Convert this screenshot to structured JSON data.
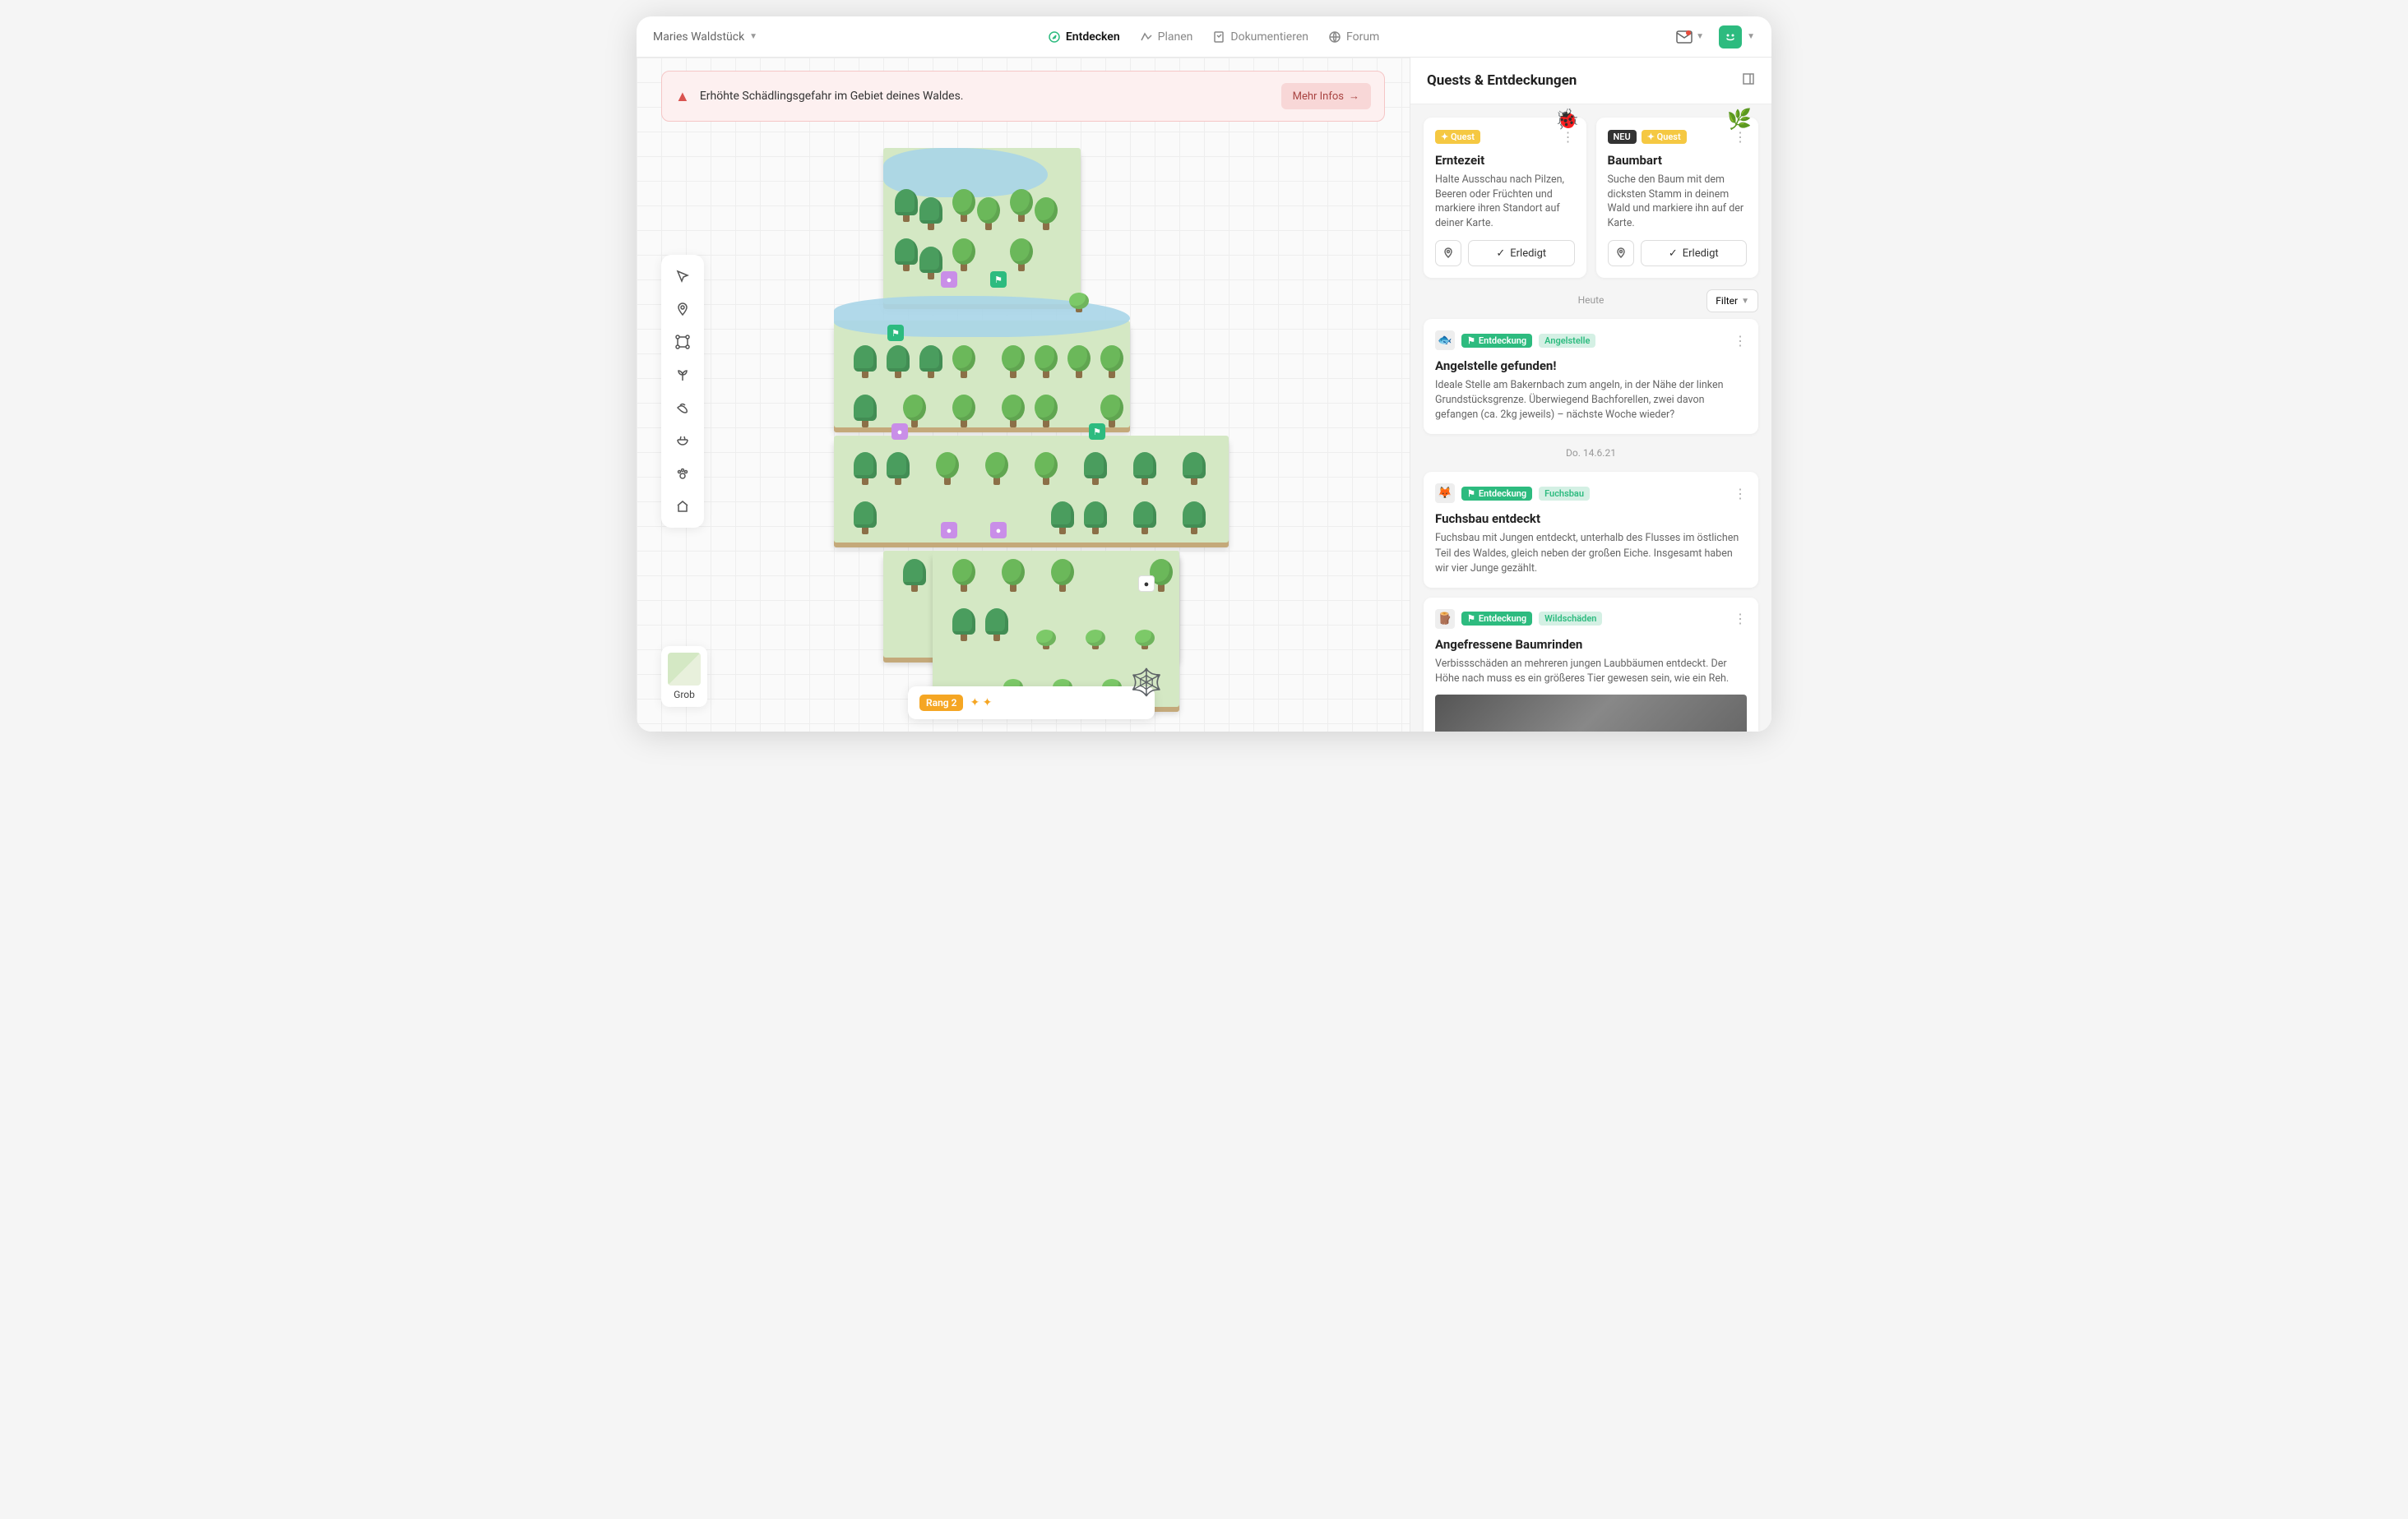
{
  "header": {
    "workspace": "Maries Waldstück",
    "tabs": [
      {
        "label": "Entdecken",
        "icon": "compass",
        "active": true
      },
      {
        "label": "Planen",
        "icon": "plan",
        "active": false
      },
      {
        "label": "Dokumentieren",
        "icon": "doc",
        "active": false
      },
      {
        "label": "Forum",
        "icon": "globe",
        "active": false
      }
    ]
  },
  "alert": {
    "text": "Erhöhte Schädlingsgefahr im Gebiet deines Waldes.",
    "button": "Mehr Infos"
  },
  "zoom": {
    "label": "Grob"
  },
  "rank": {
    "label": "Rang 2"
  },
  "sidebar": {
    "title": "Quests & Entdeckungen",
    "filter": "Filter",
    "quests": [
      {
        "new": false,
        "badge": "✦ Quest",
        "title": "Erntezeit",
        "desc": "Halte Ausschau nach Pilzen, Beeren oder Früchten und markiere ihren Standort auf deiner Karte.",
        "done": "Erledigt"
      },
      {
        "new": true,
        "newBadge": "NEU",
        "badge": "✦ Quest",
        "title": "Baumbart",
        "desc": "Suche den Baum mit dem dicksten Stamm in deinem Wald und markiere ihn auf der Karte.",
        "done": "Erledigt"
      }
    ],
    "dates": {
      "today": "Heute",
      "d1": "Do. 14.6.21"
    },
    "discoveries": [
      {
        "icon": "🐟",
        "badge": "Entdeckung",
        "tag": "Angelstelle",
        "title": "Angelstelle gefunden!",
        "desc": "Ideale Stelle am Bakernbach zum angeln, in der Nähe der linken Grundstücksgrenze. Überwiegend Bachforellen, zwei davon gefangen (ca. 2kg jeweils) – nächste Woche wieder?"
      },
      {
        "icon": "🦊",
        "badge": "Entdeckung",
        "tag": "Fuchsbau",
        "title": "Fuchsbau entdeckt",
        "desc": "Fuchsbau mit Jungen entdeckt, unterhalb des Flusses im östlichen Teil des Waldes, gleich neben der großen Eiche. Insgesamt haben wir vier Junge gezählt."
      },
      {
        "icon": "🪵",
        "badge": "Entdeckung",
        "tag": "Wildschäden",
        "title": "Angefressene Baumrinden",
        "desc": "Verbissschäden an mehreren jungen Laubbäumen entdeckt. Der Höhe nach muss es ein größeres Tier gewesen sein, wie ein Reh.",
        "hasImage": true
      }
    ]
  }
}
